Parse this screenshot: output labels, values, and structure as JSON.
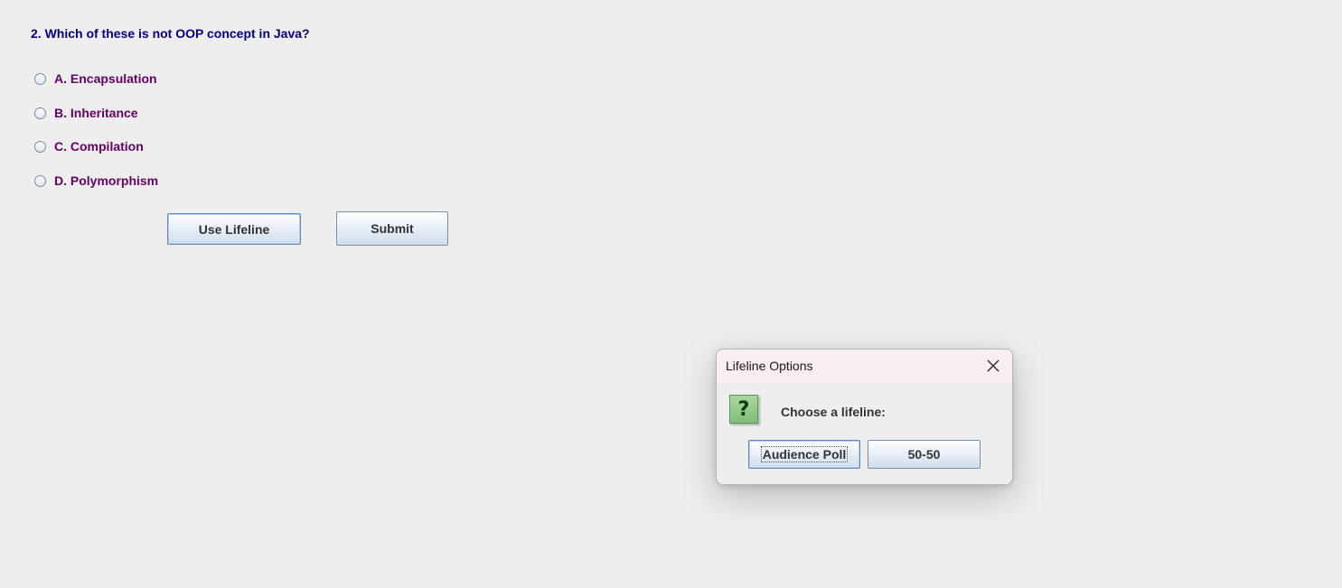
{
  "question": "2. Which of these is not OOP concept in Java?",
  "options": [
    {
      "label": "A. Encapsulation"
    },
    {
      "label": "B. Inheritance"
    },
    {
      "label": "C. Compilation"
    },
    {
      "label": "D. Polymorphism"
    }
  ],
  "buttons": {
    "use_lifeline": "Use Lifeline",
    "submit": "Submit"
  },
  "dialog": {
    "title": "Lifeline Options",
    "icon": "question-icon",
    "icon_glyph": "?",
    "message": "Choose a lifeline:",
    "buttons": {
      "audience_poll": "Audience Poll",
      "fifty_fifty": "50-50"
    }
  },
  "colors": {
    "question_text": "#000080",
    "option_text": "#660066",
    "background": "#eeeeee",
    "dialog_titlebar": "#f9eef0",
    "icon_green": "#8fcb88"
  }
}
